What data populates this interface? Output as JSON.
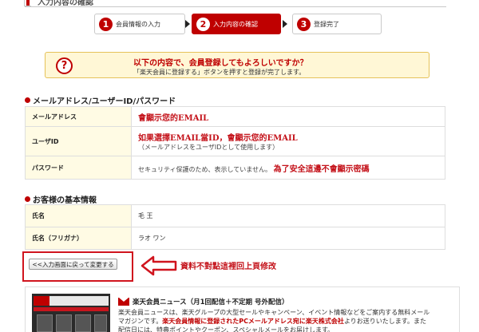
{
  "top": {
    "cut_heading": "入力内容の確認"
  },
  "steps": [
    {
      "num": "1",
      "label": "会員情報の入力"
    },
    {
      "num": "2",
      "label": "入力内容の確認"
    },
    {
      "num": "3",
      "label": "登録完了"
    }
  ],
  "confirm": {
    "question": "以下の内容で、会員登録してもよろしいですか？",
    "instruction": "「楽天会員に登録する」ボタンを押すと登録が完了します。"
  },
  "section_account": {
    "title": "メールアドレス/ユーザーID/パスワード",
    "rows": {
      "email_label": "メールアドレス",
      "email_value": "會顯示您的EMAIL",
      "userid_label": "ユーザID",
      "userid_value": "如果選擇EMAIL當ID，會顯示您的EMAIL",
      "userid_note": "（メールアドレスをユーザIDとして使用します）",
      "password_label": "パスワード",
      "password_note": "セキュリティ保護のため、表示していません。",
      "password_annotation": "為了安全這邊不會顯示密碼"
    }
  },
  "section_basic": {
    "title": "お客様の基本情報",
    "rows": {
      "name_label": "氏名",
      "name_value": "毛 王",
      "kana_label": "氏名（フリガナ）",
      "kana_value": "ラオ ワン"
    }
  },
  "back": {
    "button_label": "<<入力画面に戻って変更する",
    "annotation": "資料不對點這裡回上頁修改"
  },
  "news": {
    "heading": "楽天会員ニュース（月1回配信＋不定期 号外配信）",
    "line1": "楽天会員ニュースは、楽天グループの大型セールやキャンペーン、イベント情報などをご案内する無料メール",
    "line2_a": "マガジンです。",
    "line2_b": "楽天会員情報に登録されたPCメールアドレス宛に楽天株式会社",
    "line2_c": "よりお送りいたします。また",
    "line3": "配信日には、特典ポイントやクーポン、スペシャルメールをお届けします。",
    "banner_label": "楽天会員ニュース"
  },
  "colors": {
    "brand_red": "#bf0000",
    "confirm_bg": "#fff7d6",
    "label_bg": "#fffbe4"
  }
}
